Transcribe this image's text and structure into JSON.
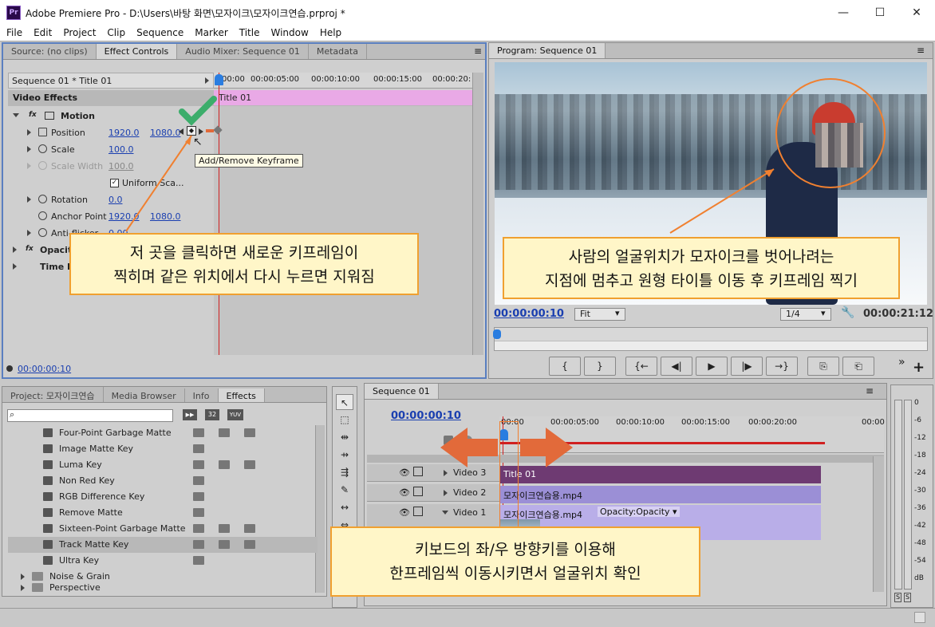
{
  "window": {
    "title": "Adobe Premiere Pro - D:\\Users\\바탕 화면\\모자이크\\모자이크연습.prproj *",
    "app_icon": "Pr",
    "min": "—",
    "max": "☐",
    "close": "✕"
  },
  "menu": [
    "File",
    "Edit",
    "Project",
    "Clip",
    "Sequence",
    "Marker",
    "Title",
    "Window",
    "Help"
  ],
  "effect_controls": {
    "tabs": [
      "Source: (no clips)",
      "Effect Controls",
      "Audio Mixer: Sequence 01",
      "Metadata"
    ],
    "tab_menu": "≡",
    "sequence_label": "Sequence 01 * Title 01",
    "ruler": [
      "00:00",
      "00:00:05:00",
      "00:00:10:00",
      "00:00:15:00",
      "00:00:20:"
    ],
    "clip_label": "Title 01",
    "video_effects": "Video Effects",
    "motion": "Motion",
    "fx": "fx",
    "position": {
      "label": "Position",
      "x": "1920.0",
      "y": "1080.0"
    },
    "scale": {
      "label": "Scale",
      "value": "100.0"
    },
    "scale_width": {
      "label": "Scale Width",
      "value": "100.0"
    },
    "uniform_scale": "Uniform Sca...",
    "rotation": {
      "label": "Rotation",
      "value": "0.0"
    },
    "anchor_point": {
      "label": "Anchor Point",
      "x": "1920.0",
      "y": "1080.0"
    },
    "anti_flicker": {
      "label": "Anti-flicker",
      "value": "0.00"
    },
    "opacity": "Opacit",
    "time_remap": "Time R",
    "tooltip": "Add/Remove Keyframe",
    "timecode": "00:00:00:10",
    "callout_line1": "저 곳을 클릭하면 새로운 키프레임이",
    "callout_line2": "찍히며 같은 위치에서 다시 누르면 지워짐"
  },
  "program_monitor": {
    "tab": "Program: Sequence 01",
    "timecode": "00:00:00:10",
    "fit": "Fit",
    "quality": "1/4",
    "duration": "00:00:21:12",
    "callout_line1": "사람의 얼굴위치가 모자이크를 벗어나려는",
    "callout_line2": "지점에 멈추고 원형 타이틀 이동 후 키프레임 찍기",
    "buttons": [
      "{",
      "}",
      "{←",
      "◀|",
      "▶",
      "|▶",
      "→}",
      "⎘",
      "⎗"
    ],
    "more": "»",
    "add": "+"
  },
  "effects_panel": {
    "tabs": [
      "Project: 모자이크연습",
      "Media Browser",
      "Info",
      "Effects"
    ],
    "search_placeholder": "",
    "badges": [
      "32",
      "YUV"
    ],
    "items": [
      "Four-Point Garbage Matte",
      "Image Matte Key",
      "Luma Key",
      "Non Red Key",
      "RGB Difference Key",
      "Remove Matte",
      "Sixteen-Point Garbage Matte",
      "Track Matte Key",
      "Ultra Key"
    ],
    "folder": "Noise & Grain",
    "folder_next": "Perspective"
  },
  "timeline": {
    "tab": "Sequence 01",
    "timecode": "00:00:00:10",
    "ruler": [
      "00:00",
      "00:00:05:00",
      "00:00:10:00",
      "00:00:15:00",
      "00:00:20:00",
      "00:00"
    ],
    "tracks": [
      "Video 3",
      "Video 2",
      "Video 1"
    ],
    "clips": {
      "title": "Title 01",
      "video2": "모자이크연습용.mp4",
      "video1": "모자이크연습용.mp4",
      "opacity": "Opacity:Opacity ▾"
    },
    "callout_line1": "키보드의 좌/우 방향키를 이용해",
    "callout_line2": "한프레임씩 이동시키면서 얼굴위치 확인"
  },
  "audio_meter": {
    "labels": [
      "0",
      "-6",
      "-12",
      "-18",
      "-24",
      "-30",
      "-36",
      "-42",
      "-48",
      "-54",
      "dB"
    ],
    "solo": [
      "S",
      "S"
    ]
  },
  "colors": {
    "accent": "#1a3fb0",
    "callout_border": "#f0a030",
    "arrow": "#e26a3a",
    "check": "#3cad6b",
    "title_clip": "#6e3a72",
    "video_clip": "#9b8fd6"
  }
}
